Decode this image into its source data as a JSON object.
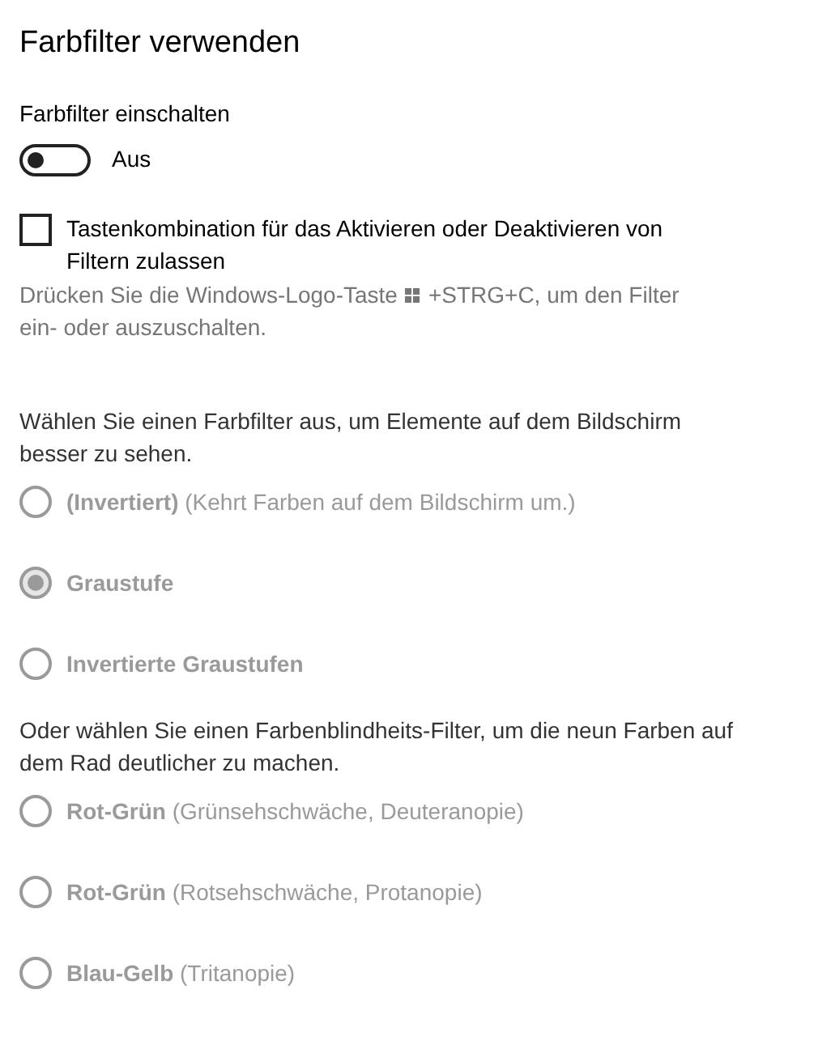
{
  "title": "Farbfilter verwenden",
  "toggle": {
    "label": "Farbfilter einschalten",
    "on": false,
    "state_text": "Aus"
  },
  "shortcut": {
    "label": "Tastenkombination für das Aktivieren oder Deaktivieren von Filtern zulassen",
    "checked": false,
    "hint_before": "Drücken Sie die Windows-Logo-Taste",
    "hint_after": "+STRG+C, um den Filter",
    "hint_end": "ein- oder auszuschalten."
  },
  "filter_intro": "Wählen Sie einen Farbfilter aus, um Elemente auf dem Bildschirm besser zu sehen.",
  "filters": [
    {
      "label": "**(Invertiert)** (Kehrt Farben auf dem Bildschirm um.)",
      "selected": false,
      "disabled": true
    },
    {
      "label": "**Graustufe**",
      "selected": true,
      "disabled": true
    },
    {
      "label": "**Invertierte Graustufen**",
      "selected": false,
      "disabled": true
    }
  ],
  "colorblind_intro": "Oder wählen Sie einen Farbenblindheits-Filter, um die neun Farben auf dem Rad deutlicher zu machen.",
  "colorblind_filters": [
    {
      "label": "**Rot-Grün** (Grünsehschwäche, Deuteranopie)",
      "selected": false,
      "disabled": true
    },
    {
      "label": "**Rot-Grün** (Rotsehschwäche, Protanopie)",
      "selected": false,
      "disabled": true
    },
    {
      "label": "**Blau-Gelb** (Tritanopie)",
      "selected": false,
      "disabled": true
    }
  ]
}
